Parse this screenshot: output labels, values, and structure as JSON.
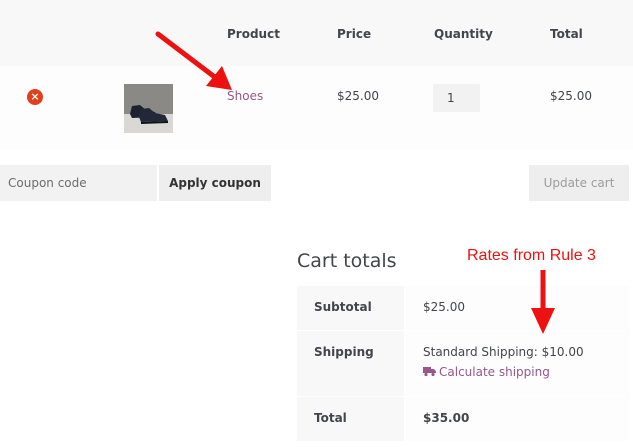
{
  "cart": {
    "headers": {
      "product": "Product",
      "price": "Price",
      "quantity": "Quantity",
      "total": "Total"
    },
    "row": {
      "remove_symbol": "×",
      "product_name": "Shoes",
      "price": "$25.00",
      "quantity": "1",
      "subtotal": "$25.00"
    }
  },
  "coupon": {
    "placeholder": "Coupon code",
    "apply_label": "Apply coupon",
    "update_label": "Update cart"
  },
  "totals": {
    "title": "Cart totals",
    "subtotal_label": "Subtotal",
    "subtotal_value": "$25.00",
    "shipping_label": "Shipping",
    "shipping_value": "Standard Shipping: $10.00",
    "calculate_label": "Calculate shipping",
    "total_label": "Total",
    "total_value": "$35.00"
  },
  "annotation": {
    "text": "Rates from Rule 3",
    "color": "#ee1111"
  },
  "colors": {
    "link": "#96588a",
    "remove": "#e2401c"
  }
}
